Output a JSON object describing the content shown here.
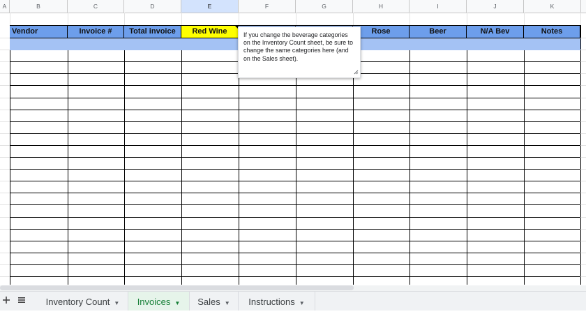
{
  "column_letters": [
    "A",
    "B",
    "C",
    "D",
    "E",
    "F",
    "G",
    "H",
    "I",
    "J",
    "K"
  ],
  "selected_column": "E",
  "header_row": {
    "vendor": "Vendor",
    "invoice_no": "Invoice #",
    "total_invoice": "Total invoice",
    "red_wine": "Red Wine",
    "rose": "Rose",
    "beer": "Beer",
    "na_bev": "N/A Bev",
    "notes": "Notes"
  },
  "note_text": "If you change the beverage categories on the Inventory Count sheet, be sure to change the same categories here (and on the Sales sheet).",
  "tabs": [
    {
      "label": "Inventory Count",
      "active": false
    },
    {
      "label": "Invoices",
      "active": true
    },
    {
      "label": "Sales",
      "active": false
    },
    {
      "label": "Instructions",
      "active": false
    }
  ],
  "colors": {
    "header_fill": "#6d9eeb",
    "highlight_fill": "#ffff00",
    "selected_row_fill": "#a4c2f4",
    "active_tab_text": "#188038"
  },
  "icons": [
    "add-sheet-icon",
    "all-sheets-icon",
    "caret-down-icon",
    "resize-handle-icon"
  ]
}
